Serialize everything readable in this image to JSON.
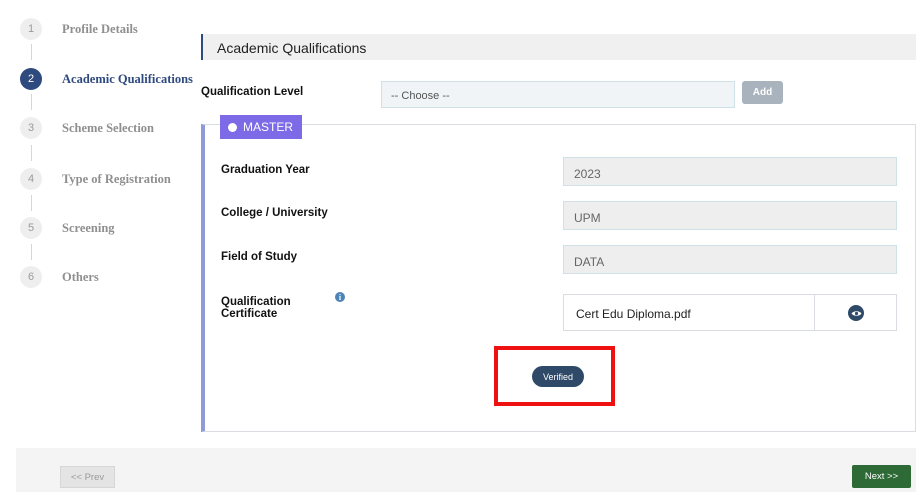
{
  "steps": [
    {
      "num": "1",
      "label": "Profile Details"
    },
    {
      "num": "2",
      "label": "Academic Qualifications"
    },
    {
      "num": "3",
      "label": "Scheme Selection"
    },
    {
      "num": "4",
      "label": "Type of Registration"
    },
    {
      "num": "5",
      "label": "Screening"
    },
    {
      "num": "6",
      "label": "Others"
    }
  ],
  "active_step": 2,
  "section_title": "Academic Qualifications",
  "qualification": {
    "label": "Qualification Level",
    "select_value": "-- Choose --",
    "add_label": "Add"
  },
  "card": {
    "tab_label": "MASTER",
    "fields": [
      {
        "label": "Graduation Year",
        "value": "2023"
      },
      {
        "label": "College / University",
        "value": "UPM"
      },
      {
        "label": "Field of Study",
        "value": "DATA"
      }
    ],
    "certificate": {
      "label_line1": "Qualification",
      "label_line2": "Certificate",
      "info_glyph": "i",
      "file_name": "Cert Edu Diploma.pdf"
    },
    "verified_label": "Verified"
  },
  "nav": {
    "prev_label": "<< Prev",
    "next_label": "Next >>"
  },
  "colors": {
    "accent": "#2f4a7e",
    "master_tab": "#7d6ae6",
    "card_border": "#8e9bd6",
    "highlight": "#ee1111",
    "next_button": "#2d6a36"
  }
}
